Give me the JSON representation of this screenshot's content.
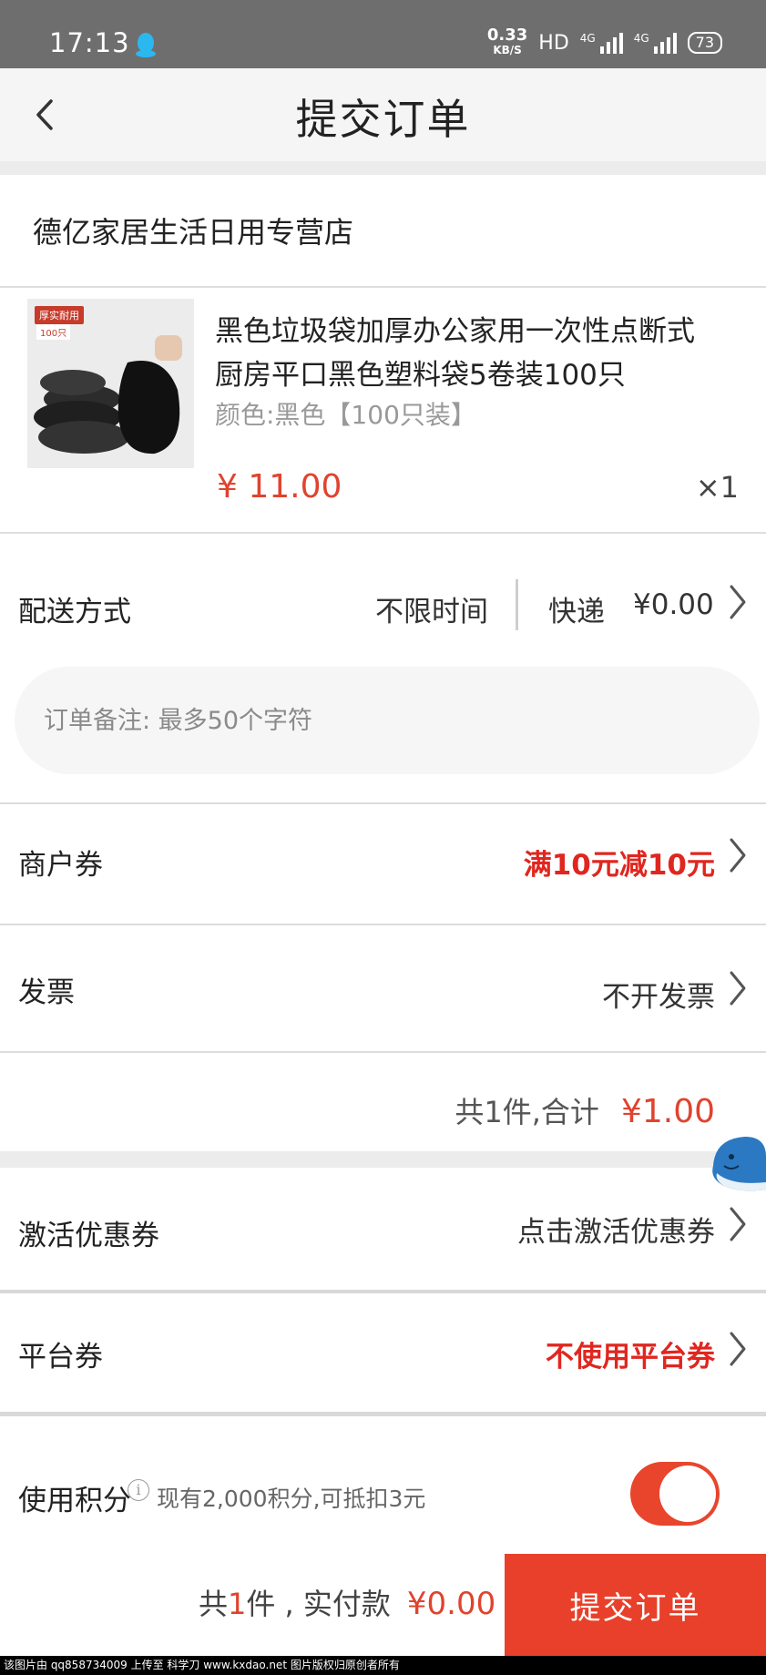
{
  "status_bar": {
    "time": "17:13",
    "net_speed": "0.33",
    "net_unit": "KB/S",
    "hd": "HD",
    "sig1": "4G",
    "sig2": "4G",
    "battery": "73"
  },
  "header": {
    "title": "提交订单"
  },
  "store": {
    "name": "德亿家居生活日用专营店"
  },
  "product": {
    "image_tag": "厚实耐用",
    "image_tag2": "100只",
    "title": "黑色垃圾袋加厚办公家用一次性点断式厨房平口黑色塑料袋5卷装100只",
    "spec": "颜色:黑色【100只装】",
    "price": "¥ 11.00",
    "qty": "×1"
  },
  "delivery": {
    "label": "配送方式",
    "time": "不限时间",
    "method": "快递",
    "fee": "¥0.00"
  },
  "remark": {
    "placeholder": "订单备注: 最多50个字符"
  },
  "merchant_coupon": {
    "label": "商户券",
    "value": "满10元减10元"
  },
  "invoice": {
    "label": "发票",
    "value": "不开发票"
  },
  "summary": {
    "text": "共1件,合计",
    "amount": "¥1.00"
  },
  "activate_coupon": {
    "label": "激活优惠券",
    "value": "点击激活优惠券"
  },
  "platform_coupon": {
    "label": "平台券",
    "value": "不使用平台券"
  },
  "points": {
    "label": "使用积分",
    "info": "i",
    "desc": "现有2,000积分,可抵扣3元",
    "enabled": true
  },
  "bottom": {
    "prefix": "共",
    "count": "1",
    "suffix": "件 , 实付款",
    "amount": "¥0.00",
    "submit_label": "提交订单"
  },
  "watermark": "该图片由 qq858734009 上传至 科学刀 www.kxdao.net 图片版权归原创者所有",
  "colors": {
    "accent": "#e8402a",
    "price": "#e0432e",
    "status_bar": "#6e6e6e"
  }
}
